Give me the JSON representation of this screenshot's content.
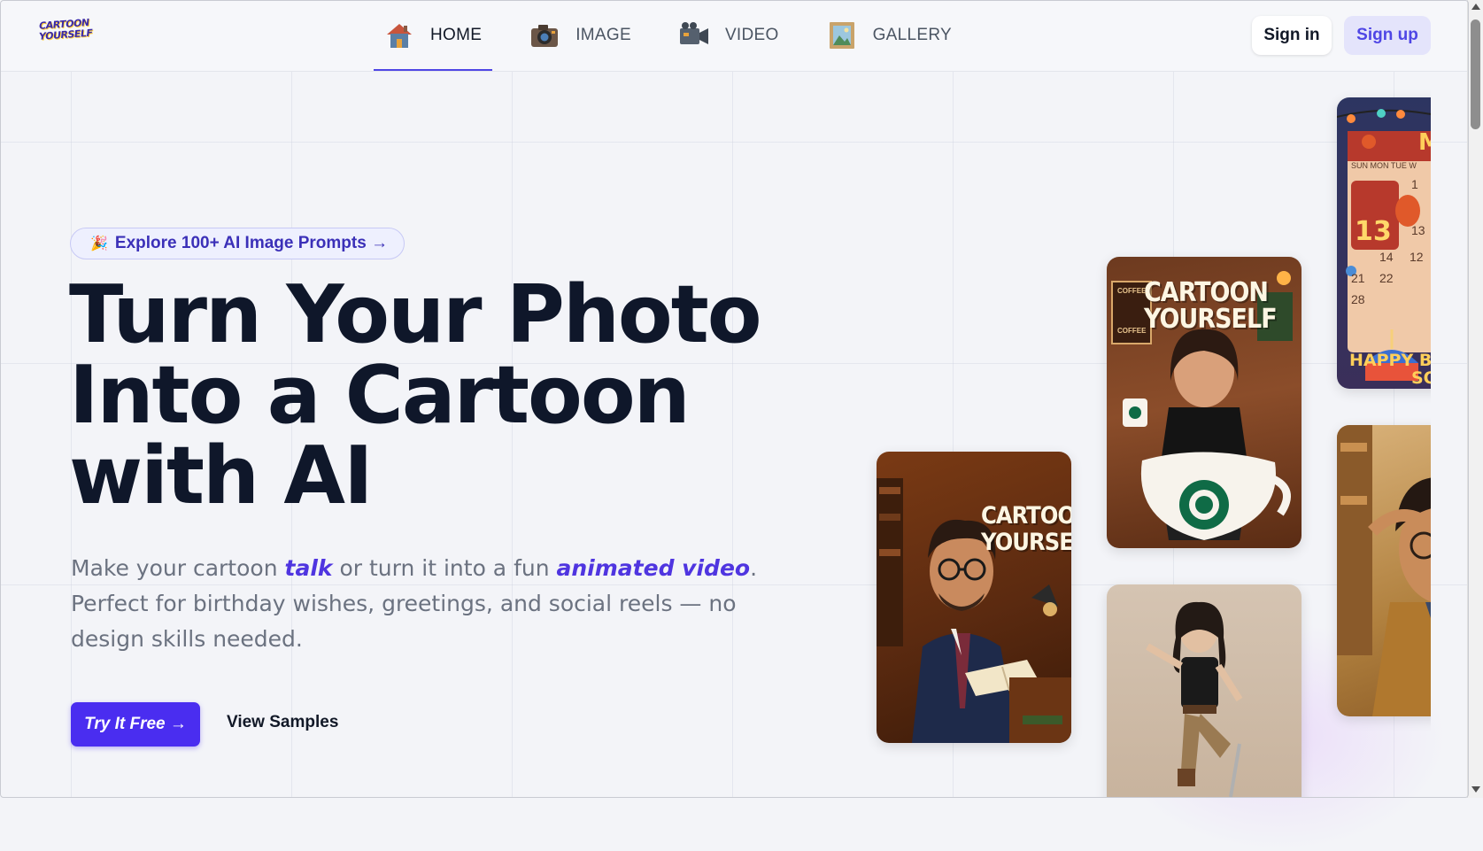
{
  "logo": {
    "line1": "CARTOON",
    "line2": "YOURSELF"
  },
  "nav": {
    "items": [
      {
        "label": "HOME",
        "icon": "house-icon",
        "active": true
      },
      {
        "label": "IMAGE",
        "icon": "camera-icon",
        "active": false
      },
      {
        "label": "VIDEO",
        "icon": "video-camera-icon",
        "active": false
      },
      {
        "label": "GALLERY",
        "icon": "picture-frame-icon",
        "active": false
      }
    ]
  },
  "auth": {
    "signin_label": "Sign in",
    "signup_label": "Sign up"
  },
  "hero": {
    "pill_icon": "🎉",
    "pill_label": "Explore 100+ AI Image Prompts →",
    "headline_1": "Turn Your Photo",
    "headline_2": "Into a Cartoon",
    "headline_3": "with AI",
    "sub_a": "Make your cartoon ",
    "sub_talk": "talk",
    "sub_b": " or turn it into a fun ",
    "sub_video": "animated video",
    "sub_c": ".",
    "sub_line2": "Perfect for birthday wishes, greetings, and social reels — no design skills needed.",
    "try_label": "Try It Free →",
    "samples_label": "View Samples"
  },
  "cards": {
    "man_line1": "CARTOON",
    "man_line2": "YOURSELF",
    "woman_line1": "CARTOON",
    "woman_line2": "YOURSELF",
    "woman_sign": "COFFEE",
    "woman_sign2": "COFFEE",
    "cal_month": "MA",
    "cal_days": "SUN MON TUE W",
    "cal_n1": "1",
    "cal_13": "13",
    "cal_13b": "13",
    "cal_14": "14",
    "cal_12": "12",
    "cal_21": "21",
    "cal_22": "22",
    "cal_28": "28",
    "cal_happy": "HAPPY B",
    "cal_so": "SO"
  },
  "colors": {
    "accent": "#4f46e5",
    "primary_button": "#4a2df0",
    "headline": "#0f172a"
  }
}
